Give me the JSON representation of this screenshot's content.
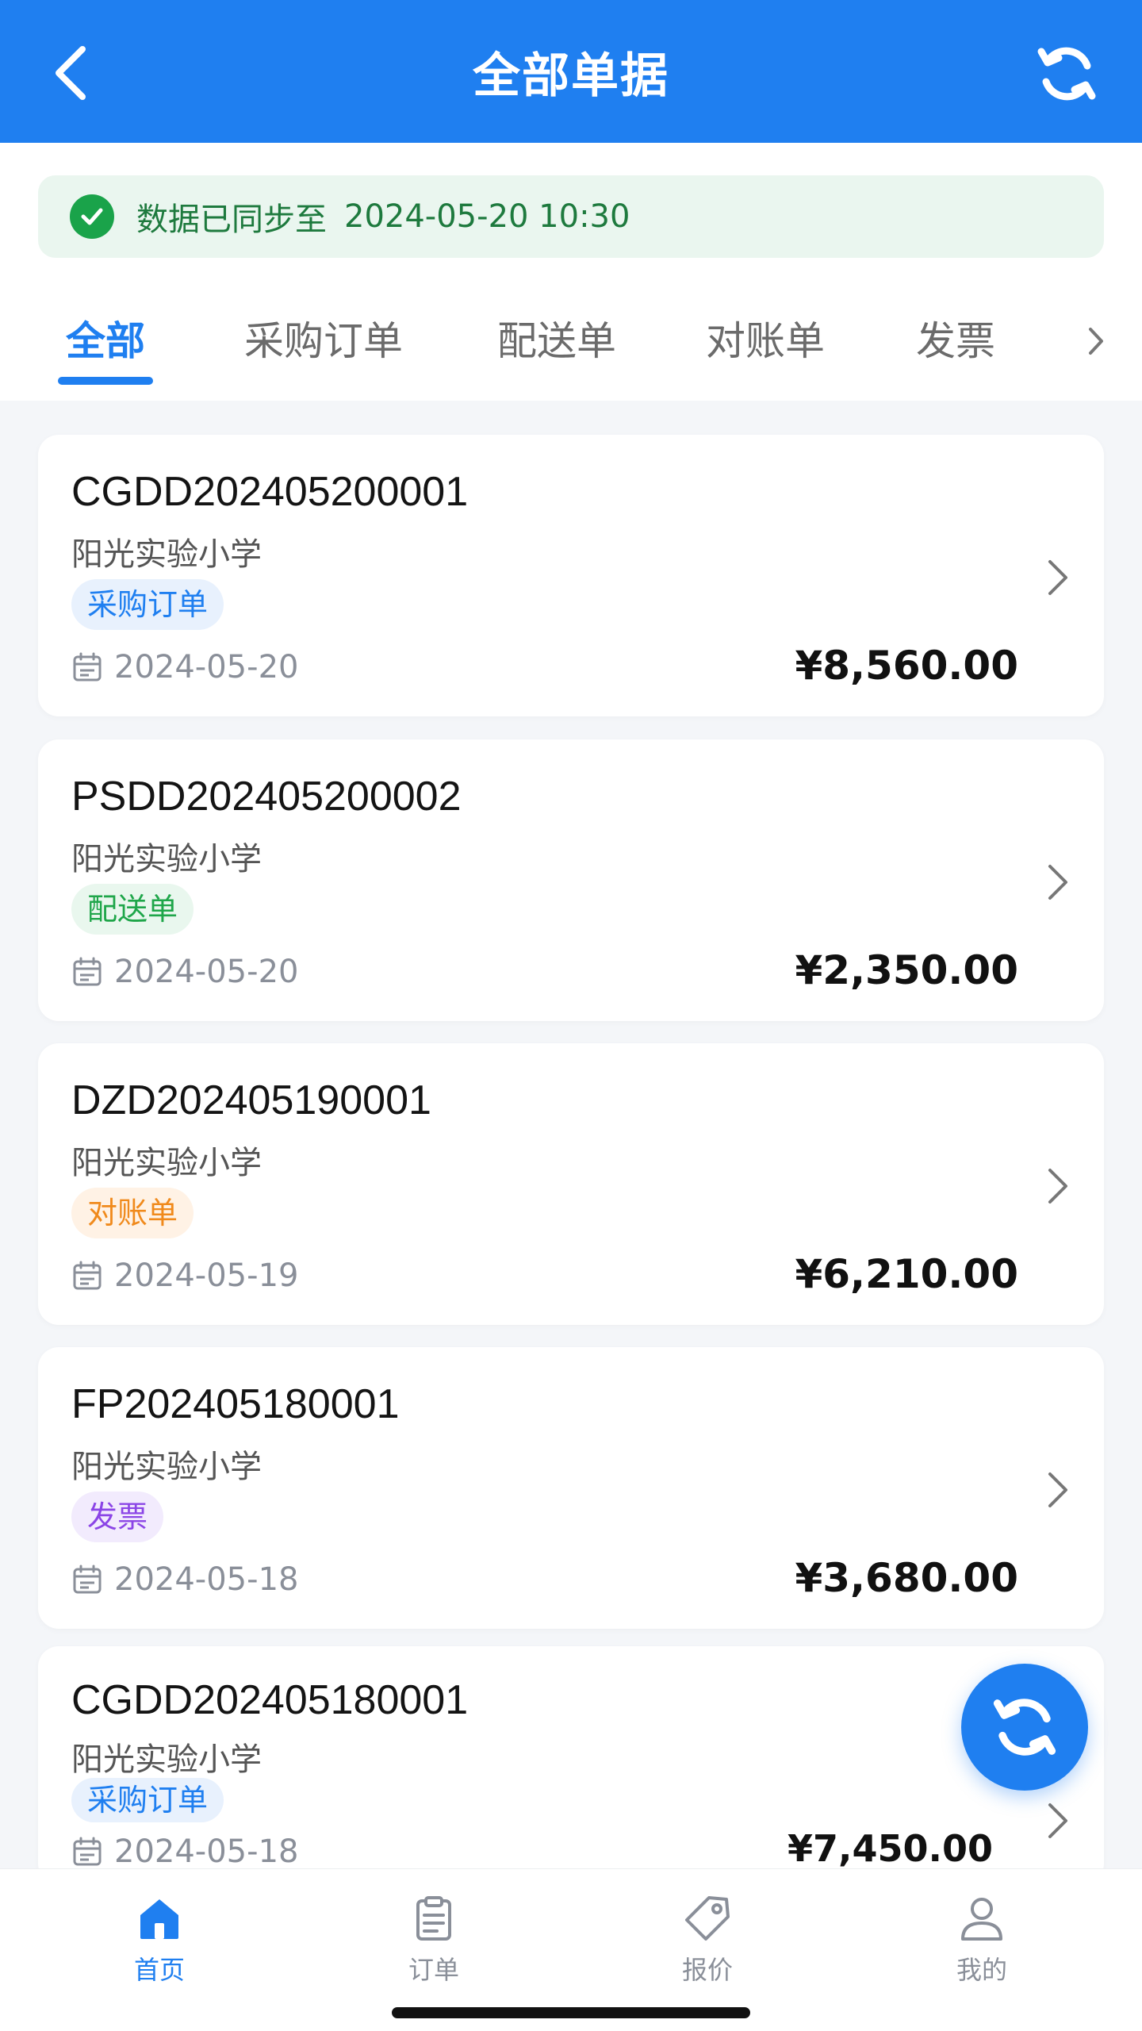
{
  "header": {
    "title": "全部单据"
  },
  "sync": {
    "text": "数据已同步至",
    "time": "2024-05-20 10:30"
  },
  "tabs": [
    {
      "label": "全部",
      "active": true
    },
    {
      "label": "采购订单"
    },
    {
      "label": "配送单"
    },
    {
      "label": "对账单"
    },
    {
      "label": "发票"
    }
  ],
  "documents": [
    {
      "doc_no": "CGDD202405200001",
      "school": "阳光实验小学",
      "type": "采购订单",
      "date": "2024-05-20",
      "amount": "¥8,560.00"
    },
    {
      "doc_no": "PSDD202405200002",
      "school": "阳光实验小学",
      "type": "配送单",
      "date": "2024-05-20",
      "amount": "¥2,350.00"
    },
    {
      "doc_no": "DZD202405190001",
      "school": "阳光实验小学",
      "type": "对账单",
      "date": "2024-05-19",
      "amount": "¥6,210.00"
    },
    {
      "doc_no": "FP202405180001",
      "school": "阳光实验小学",
      "type": "发票",
      "date": "2024-05-18",
      "amount": "¥3,680.00"
    },
    {
      "doc_no": "CGDD202405180001",
      "school": "阳光实验小学",
      "type": "采购订单",
      "date": "2024-05-18",
      "amount": "¥7,450.00"
    }
  ],
  "bottom_nav": [
    {
      "label": "首页",
      "icon": "home-icon",
      "active": true
    },
    {
      "label": "订单",
      "icon": "clipboard-icon"
    },
    {
      "label": "报价",
      "icon": "tag-icon"
    },
    {
      "label": "我的",
      "icon": "user-icon"
    }
  ],
  "colors": {
    "primary": "#1f7ff0",
    "success": "#1aa34a",
    "purchase_badge": "#1f7ff0",
    "delivery_badge": "#1fa64a",
    "reconcile_badge": "#f08a1c",
    "invoice_badge": "#8b45e6"
  }
}
